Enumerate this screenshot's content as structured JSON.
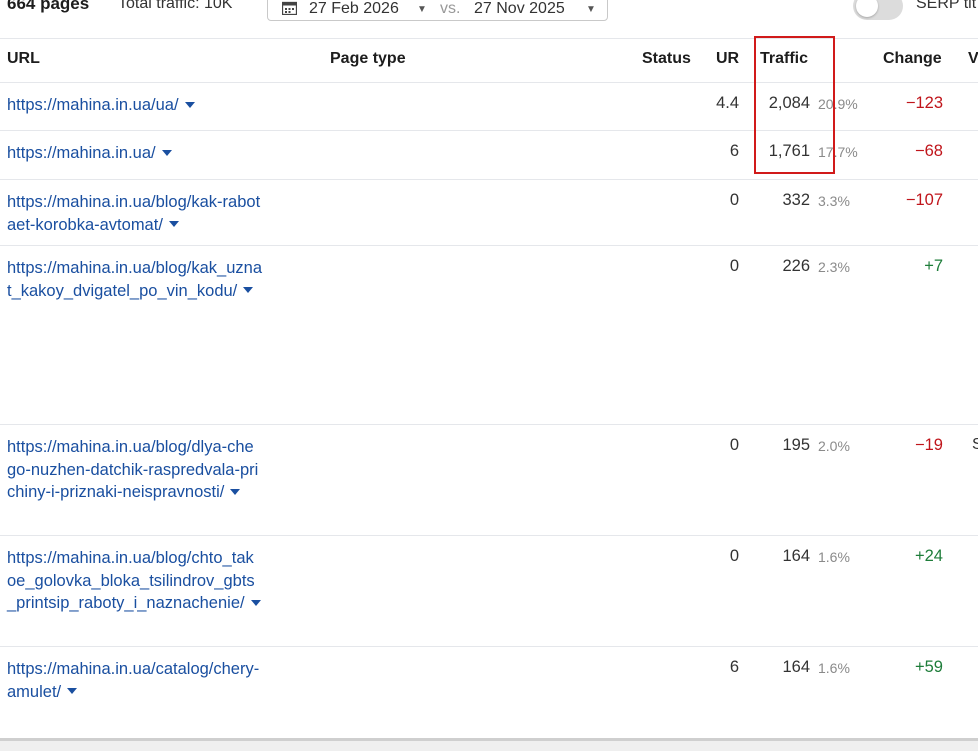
{
  "summary": {
    "pages": "664 pages",
    "total_traffic": "Total traffic: 10K"
  },
  "date_range": {
    "current": "27 Feb 2026",
    "vs": "vs.",
    "previous": "27 Nov 2025"
  },
  "serp_toggle": {
    "label": "SERP tit",
    "on": false
  },
  "columns": {
    "url": "URL",
    "page_type": "Page type",
    "status": "Status",
    "ur": "UR",
    "traffic": "Traffic",
    "change": "Change",
    "next": "V"
  },
  "rows": [
    {
      "url": "https://mahina.in.ua/ua/",
      "ur": "4.4",
      "traffic": "2,084",
      "pct": "20.9%",
      "change": "−123",
      "change_sign": "neg"
    },
    {
      "url": "https://mahina.in.ua/",
      "ur": "6",
      "traffic": "1,761",
      "pct": "17.7%",
      "change": "−68",
      "change_sign": "neg"
    },
    {
      "url": "https://mahina.in.ua/blog/kak-rabotaet-korobka-avtomat/",
      "ur": "0",
      "traffic": "332",
      "pct": "3.3%",
      "change": "−107",
      "change_sign": "neg"
    },
    {
      "url": "https://mahina.in.ua/blog/kak_uznat_kakoy_dvigatel_po_vin_kodu/",
      "ur": "0",
      "traffic": "226",
      "pct": "2.3%",
      "change": "+7",
      "change_sign": "pos"
    },
    {
      "url": "https://mahina.in.ua/blog/dlya-chego-nuzhen-datchik-raspredvala-prichiny-i-priznaki-neispravnosti/",
      "ur": "0",
      "traffic": "195",
      "pct": "2.0%",
      "change": "−19",
      "change_sign": "neg",
      "edge": "S"
    },
    {
      "url": "https://mahina.in.ua/blog/chto_takoe_golovka_bloka_tsilindrov_gbts_printsip_raboty_i_naznachenie/",
      "ur": "0",
      "traffic": "164",
      "pct": "1.6%",
      "change": "+24",
      "change_sign": "pos"
    },
    {
      "url": "https://mahina.in.ua/catalog/chery-amulet/",
      "ur": "6",
      "traffic": "164",
      "pct": "1.6%",
      "change": "+59",
      "change_sign": "pos"
    }
  ],
  "colors": {
    "link": "#1a4fa0",
    "negative": "#c0151b",
    "positive": "#1e7d3a",
    "highlight": "#d11a1a"
  }
}
